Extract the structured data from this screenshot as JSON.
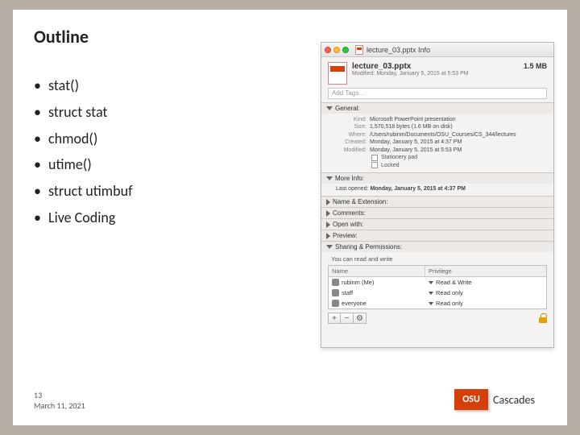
{
  "slide": {
    "title": "Outline",
    "bullets": [
      "stat()",
      "struct stat",
      "chmod()",
      "utime()",
      "struct utimbuf",
      "Live Coding"
    ],
    "page_number": "13",
    "date": "March 11, 2021"
  },
  "logo": {
    "badge": "OSU",
    "text": "Cascades"
  },
  "info_window": {
    "window_title": "lecture_03.pptx Info",
    "file_name": "lecture_03.pptx",
    "modified_line": "Modified: Monday, January 5, 2015 at 5:53 PM",
    "file_size": "1.5 MB",
    "add_tags_placeholder": "Add Tags…",
    "sections": {
      "general": {
        "label": "General:",
        "kind_label": "Kind:",
        "kind_value": "Microsoft PowerPoint presentation",
        "size_label": "Size:",
        "size_value": "1,570,518 bytes (1.6 MB on disk)",
        "where_label": "Where:",
        "where_value": "/Users/rubinm/Documents/OSU_Courses/CS_344/lectures",
        "created_label": "Created:",
        "created_value": "Monday, January 5, 2015 at 4:37 PM",
        "modified_label": "Modified:",
        "modified_value": "Monday, January 5, 2015 at 5:53 PM",
        "stationery_label": "Stationery pad",
        "locked_label": "Locked"
      },
      "more_info": {
        "label": "More Info:",
        "last_opened_label": "Last opened:",
        "last_opened_value": "Monday, January 5, 2015 at 4:37 PM"
      },
      "name_ext": {
        "label": "Name & Extension:"
      },
      "comments": {
        "label": "Comments:"
      },
      "open_with": {
        "label": "Open with:"
      },
      "preview": {
        "label": "Preview:"
      },
      "sharing": {
        "label": "Sharing & Permissions:",
        "message": "You can read and write",
        "columns": {
          "name": "Name",
          "privilege": "Privilege"
        },
        "rows": [
          {
            "user": "rubinm (Me)",
            "priv": "Read & Write"
          },
          {
            "user": "staff",
            "priv": "Read only"
          },
          {
            "user": "everyone",
            "priv": "Read only"
          }
        ],
        "buttons": {
          "add": "+",
          "remove": "−",
          "action": "⚙"
        }
      }
    }
  }
}
